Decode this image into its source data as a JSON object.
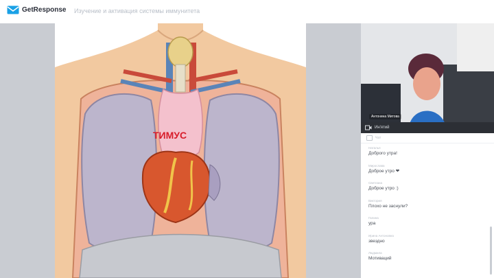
{
  "app": {
    "brand": "GetResponse",
    "webinar_title": "Изучение и активация системы иммунитета"
  },
  "slide": {
    "label": "ТИМУС",
    "colors": {
      "skin": "#f2c9a0",
      "lung": "#bcb5cc",
      "heart": "#d8572e",
      "thymus": "#f4c1cd",
      "label": "#d81c2a"
    }
  },
  "video": {
    "presenter_name": "Антонина Митова",
    "bar_label": "Ин'ятий"
  },
  "chat": {
    "title": "Чат",
    "messages": [
      {
        "author": "Наталья",
        "text": "Доброго утра!"
      },
      {
        "author": "Мирослава",
        "text": "Доброе утро ❤"
      },
      {
        "author": "Светлана",
        "text": "Доброе утро :)"
      },
      {
        "author": "Виктория",
        "text": "Плохо не заснули?"
      },
      {
        "author": "Галина",
        "text": "ура"
      },
      {
        "author": "Ирина Антоновна",
        "text": "звездно"
      },
      {
        "author": "Людмила",
        "text": "Мотиваций"
      }
    ]
  },
  "colors": {
    "accent": "#1aa1e6",
    "topbar_bg": "#ffffff",
    "stage_bg": "#c9ccd2"
  }
}
